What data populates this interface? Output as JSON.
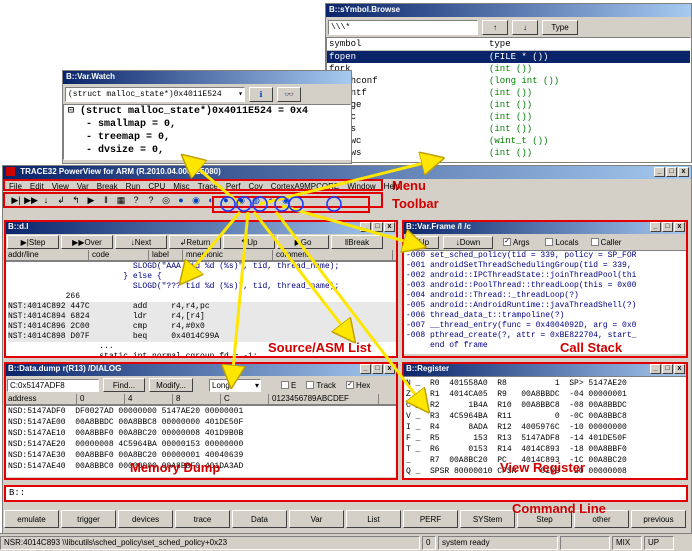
{
  "symbol_browse": {
    "title": "B::sYmbol.Browse",
    "filter": "\\\\\\*",
    "type_btn": "Type",
    "col_symbol": "symbol",
    "col_type": "type",
    "rows": [
      {
        "symbol": "fopen",
        "type": "(FILE * ())"
      },
      {
        "symbol": "fork",
        "type": "(int ())"
      },
      {
        "symbol": "fpathconf",
        "type": "(long int ())"
      },
      {
        "symbol": "fprintf",
        "type": "(int ())"
      },
      {
        "symbol": "fpurge",
        "type": "(int ())"
      },
      {
        "symbol": "fputc",
        "type": "(int ())"
      },
      {
        "symbol": "fputs",
        "type": "(int ())"
      },
      {
        "symbol": "fputwc",
        "type": "(wint_t ())"
      },
      {
        "symbol": "fputws",
        "type": "(int ())"
      }
    ]
  },
  "var_watch": {
    "title": "B::Var.Watch",
    "input": "(struct malloc_state*)0x4011E524",
    "lines": [
      "⊟ (struct malloc_state*)0x4011E524 = 0x4",
      "   - smallmap = 0,",
      "   - treemap = 0,",
      "   - dvsize = 0,"
    ]
  },
  "main": {
    "title": "TRACE32 PowerView for ARM    (R.2010.04.000025080)",
    "menu": [
      "File",
      "Edit",
      "View",
      "Var",
      "Break",
      "Run",
      "CPU",
      "Misc",
      "Trace",
      "Perf",
      "Cov",
      "CortexA9MPCORE",
      "Window",
      "Help"
    ]
  },
  "list_win": {
    "title": "B::d.l",
    "buttons": [
      "Step",
      "Over",
      "Next",
      "Return",
      "Up",
      "Go",
      "Break"
    ],
    "headers": [
      "addr/line",
      "code",
      "label",
      "mnemonic",
      "comment"
    ],
    "lines": [
      "                          SLOGD(\"AAA tid %d (%s)\", tid, thread_name);",
      "                        } else {",
      "                          SLOGD(\"??? tid %d (%s)\", tid, thread_name);",
      "            266",
      "NST:4014C892 447C         add     r4,r4,pc",
      "NST:4014C894 6824         ldr     r4,[r4]",
      "NST:4014C896 2C00         cmp     r4,#0x0",
      "NST:4014C898 D07F         beq     0x4014C99A",
      "                   ...",
      "                   static int normal_cgroup_fd = -1;"
    ]
  },
  "frame_win": {
    "title": "B::Var.Frame /l /c",
    "up_btn": "Up",
    "down_btn": "Down",
    "args_label": "Args",
    "locals_label": "Locals",
    "caller_label": "Caller",
    "lines": [
      "-000 set_sched_policy(tid = 339, policy = SP_FOR",
      "-001 androidSetThreadSchedulingGroup(tid = 339,",
      "-002 android::IPCThreadState::joinThreadPool(thi",
      "-003 android::PoolThread::threadLoop(this = 0x00",
      "-004 android::Thread::_threadLoop(?)",
      "-005 android::AndroidRuntime::javaThreadShell(?)",
      "-006 thread_data_t::trampoline(?)",
      "-007 __thread_entry(func = 0x4004092D, arg = 0x0",
      "-008 pthread_create(?, attr = 0xBE822704, start_",
      "     end of frame"
    ]
  },
  "dump_win": {
    "title": "B::Data.dump r(R13) /DIALOG",
    "address": "C:0x5147ADF8",
    "find_btn": "Find...",
    "modify_btn": "Modify...",
    "format": "Long",
    "e_label": "E",
    "track_label": "Track",
    "hex_label": "Hex",
    "headers": [
      "address",
      "0",
      "4",
      "8",
      "C",
      "0123456789ABCDEF"
    ],
    "rows": [
      "NSD:5147ADF0  DF0027AD 00000000 5147AE20 00000001",
      "NSD:5147AE00  00A8BBDC 00A8BBC8 00000000 401DE50F",
      "NSD:5147AE10  00A8BBF0 00A8BC20 00000008 401D9B0B",
      "NSD:5147AE20  00000008 4C5964BA 00000153 00000000",
      "NSD:5147AE30  00A8BBF0 00A8BC20 00000001 40040639",
      "NSD:5147AE40  00A8BBC0 00000000 00A8BBF0 401DA3AD"
    ]
  },
  "reg_win": {
    "title": "B::Register",
    "rows": [
      "N _  R0  401558A0  R8          1  SP> 5147AE20",
      "Z _  R1  4014CA05  R9   00A8BBDC  -04 00000001",
      "C _  R2      1B4A  R10  00A8BBC8  -08 00A8BBDC",
      "V _  R3  4C5964BA  R11         0  -0C 00A8BBC8",
      "I _  R4      8ADA  R12  4005976C  -10 00000000",
      "F _  R5       153  R13  5147ADF8  -14 401DE50F",
      "T _  R6      0153  R14  4014C893  -18 00A8BBF0",
      "_    R7  00A8BC20  PC   4014C893  -1C 00A8BC20",
      "Q _  SPSR 80000010 CPSR     0103  -20 00000008"
    ]
  },
  "command_line": {
    "value": "B::"
  },
  "softkeys": [
    "emulate",
    "trigger",
    "devices",
    "trace",
    "Data",
    "Var",
    "List",
    "PERF",
    "SYStem",
    "Step",
    "other",
    "previous"
  ],
  "status": {
    "location": "NSR:4014C893 \\\\libcutils\\sched_policy\\set_sched_policy+0x23",
    "zero": "0",
    "state": "system ready",
    "mix": "MIX",
    "up": "UP"
  },
  "annotations": {
    "menu": "Menu",
    "toolbar": "Toolbar",
    "source_asm": "Source/ASM List",
    "call_stack": "Call Stack",
    "memory_dump": "Memory Dump",
    "view_register": "View Register",
    "command_line": "Command Line"
  },
  "colors": {
    "annotation_red": "#d00000",
    "arrow_yellow": "#ffe600",
    "title_blue": "#0a246a",
    "highlight_blue": "#0a246a"
  }
}
